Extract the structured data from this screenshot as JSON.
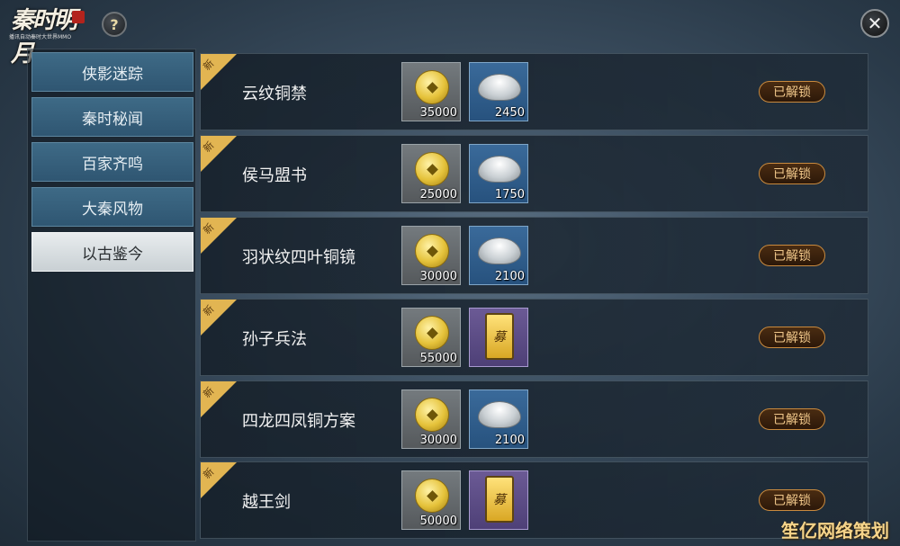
{
  "header": {
    "logo_title": "秦时明月",
    "logo_subtitle": "播讯自动秦时大世界MMO",
    "help_label": "?",
    "close_label": "✕"
  },
  "sidebar": {
    "tabs": [
      {
        "label": "侠影迷踪",
        "active": false
      },
      {
        "label": "秦时秘闻",
        "active": false
      },
      {
        "label": "百家齐鸣",
        "active": false
      },
      {
        "label": "大秦风物",
        "active": false
      },
      {
        "label": "以古鉴今",
        "active": true
      }
    ]
  },
  "items": [
    {
      "new_label": "新",
      "name": "云纹铜禁",
      "coin_cost": "35000",
      "second_type": "ingot",
      "second_cost": "2450",
      "status": "已解锁"
    },
    {
      "new_label": "新",
      "name": "侯马盟书",
      "coin_cost": "25000",
      "second_type": "ingot",
      "second_cost": "1750",
      "status": "已解锁"
    },
    {
      "new_label": "新",
      "name": "羽状纹四叶铜镜",
      "coin_cost": "30000",
      "second_type": "ingot",
      "second_cost": "2100",
      "status": "已解锁"
    },
    {
      "new_label": "新",
      "name": "孙子兵法",
      "coin_cost": "55000",
      "second_type": "token",
      "second_cost": "",
      "status": "已解锁"
    },
    {
      "new_label": "新",
      "name": "四龙四凤铜方案",
      "coin_cost": "30000",
      "second_type": "ingot",
      "second_cost": "2100",
      "status": "已解锁"
    },
    {
      "new_label": "新",
      "name": "越王剑",
      "coin_cost": "50000",
      "second_type": "token",
      "second_cost": "",
      "status": "已解锁"
    }
  ],
  "token_glyph": "募",
  "watermark": "笙亿网络策划",
  "colors": {
    "ribbon": "#e2b552",
    "active_tab": "#dfe4e7",
    "tab": "#3a6480",
    "badge_border": "#c98a3e",
    "badge_text": "#f0c78a"
  }
}
